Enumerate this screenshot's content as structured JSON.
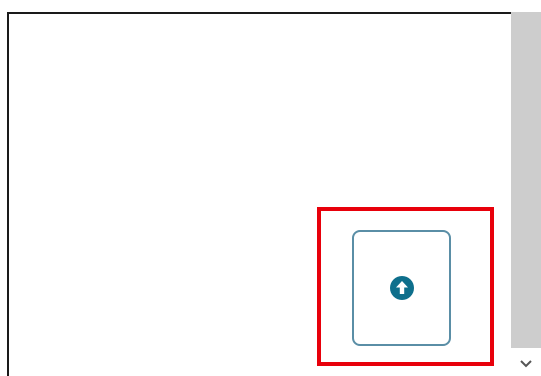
{
  "upload_button": {
    "icon": "arrow-up-circle-icon",
    "icon_color": "#0e6f8c",
    "border_color": "#5a8ea6"
  },
  "highlight": {
    "color": "#e8000b"
  },
  "scrollbar": {
    "down_arrow_icon": "chevron-down-icon"
  }
}
